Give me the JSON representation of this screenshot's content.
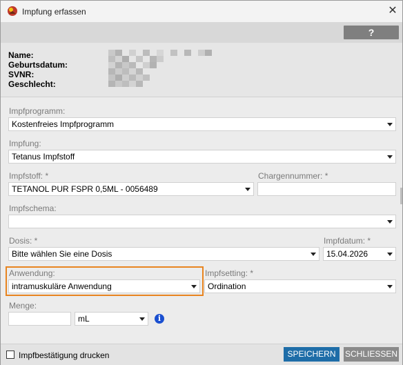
{
  "window": {
    "title": "Impfung erfassen",
    "close_glyph": "✕",
    "help_label": "?"
  },
  "patient": {
    "labels": [
      "Name:",
      "Geburtsdatum:",
      "SVNR:",
      "Geschlecht:"
    ]
  },
  "form": {
    "impfprogramm": {
      "label": "Impfprogramm:",
      "value": "Kostenfreies Impfprogramm"
    },
    "impfung": {
      "label": "Impfung:",
      "value": "Tetanus Impfstoff"
    },
    "impfstoff": {
      "label": "Impfstoff: *",
      "value": "TETANOL PUR FSPR 0,5ML - 0056489"
    },
    "chargennummer": {
      "label": "Chargennummer: *",
      "value": ""
    },
    "impfschema": {
      "label": "Impfschema:",
      "value": ""
    },
    "dosis": {
      "label": "Dosis: *",
      "value": "Bitte wählen Sie eine Dosis"
    },
    "impfdatum": {
      "label": "Impfdatum: *",
      "value": "15.04.2026"
    },
    "anwendung": {
      "label": "Anwendung:",
      "value": "intramuskuläre Anwendung"
    },
    "impfsetting": {
      "label": "Impfsetting: *",
      "value": "Ordination"
    },
    "menge": {
      "label": "Menge:",
      "value": "",
      "unit": "mL"
    }
  },
  "footer": {
    "print_label": "Impfbestätigung drucken",
    "print_checked": false,
    "save_label": "SPEICHERN",
    "close_label": "SCHLIESSEN"
  },
  "colors": {
    "accent": "#1e6da8",
    "highlight": "#e8841f",
    "info": "#1a4fd0"
  },
  "icons": {
    "app": "app-logo-icon",
    "info": "info-icon",
    "close": "close-icon"
  }
}
